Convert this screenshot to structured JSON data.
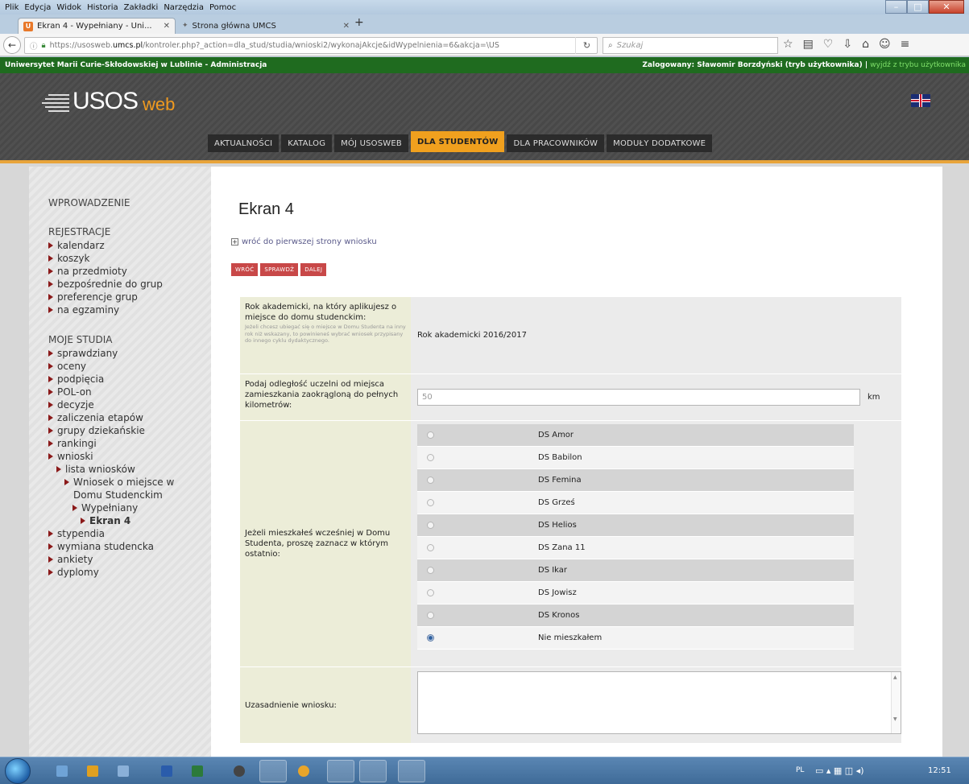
{
  "browser": {
    "menu": [
      "Plik",
      "Edycja",
      "Widok",
      "Historia",
      "Zakładki",
      "Narzędzia",
      "Pomoc"
    ],
    "tabs": [
      {
        "title": "Ekran 4 - Wypełniany - Uni...",
        "active": true
      },
      {
        "title": "Strona główna UMCS",
        "active": false
      }
    ],
    "url": {
      "prefix": "https://usosweb.",
      "host": "umcs.pl",
      "path": "/kontroler.php?_action=dla_stud/studia/wnioski2/wykonajAkcje&idWypelnienia=6&akcja=\\US"
    },
    "search_placeholder": "Szukaj"
  },
  "admin_bar": {
    "left": "Uniwersytet Marii Curie-Skłodowskiej w Lublinie - Administracja",
    "user": "Zalogowany: Sławomir Borzdyński (tryb użytkownika) |",
    "link": "wyjdź z trybu użytkownika"
  },
  "logo": {
    "main": "USOS",
    "suffix": "web"
  },
  "main_nav": [
    {
      "label": "AKTUALNOŚCI",
      "active": false
    },
    {
      "label": "KATALOG",
      "active": false
    },
    {
      "label": "MÓJ USOSWEB",
      "active": false
    },
    {
      "label": "DLA STUDENTÓW",
      "active": true
    },
    {
      "label": "DLA PRACOWNIKÓW",
      "active": false
    },
    {
      "label": "MODUŁY DODATKOWE",
      "active": false
    }
  ],
  "sidebar": {
    "intro": "WPROWADZENIE",
    "registration": {
      "title": "REJESTRACJE",
      "items": [
        "kalendarz",
        "koszyk",
        "na przedmioty",
        "bezpośrednie do grup",
        "preferencje grup",
        "na egzaminy"
      ]
    },
    "studies": {
      "title": "MOJE STUDIA",
      "items": [
        "sprawdziany",
        "oceny",
        "podpięcia",
        "POL-on",
        "decyzje",
        "zaliczenia etapów",
        "grupy dziekańskie",
        "rankingi",
        "wnioski"
      ],
      "nested": [
        "lista wniosków",
        "Wniosek o miejsce w",
        "Domu Studenckim",
        "Wypełniany",
        "Ekran 4"
      ],
      "after": [
        "stypendia",
        "wymiana studencka",
        "ankiety",
        "dyplomy"
      ]
    }
  },
  "content": {
    "title": "Ekran 4",
    "backlink": "wróć do pierwszej strony wniosku",
    "buttons": [
      "WRÓĆ",
      "SPRAWDŹ",
      "DALEJ"
    ],
    "row_year": {
      "label": "Rok akademicki, na który aplikujesz o miejsce do domu studenckim:",
      "note": "Jeżeli chcesz ubiegać się o miejsce w Domu Studenta na inny rok niż wskazany, to powinieneś wybrać wniosek przypisany do innego cyklu dydaktycznego.",
      "value": "Rok akademicki 2016/2017"
    },
    "row_distance": {
      "label": "Podaj odległość uczelni od miejsca zamieszkania zaokrągloną do pełnych kilometrów:",
      "value": "50",
      "unit": "km"
    },
    "row_dorms": {
      "label": "Jeżeli mieszkałeś wcześniej w Domu Studenta, proszę zaznacz w którym ostatnio:",
      "options": [
        {
          "name": "DS Amor",
          "checked": false
        },
        {
          "name": "DS Babilon",
          "checked": false
        },
        {
          "name": "DS Femina",
          "checked": false
        },
        {
          "name": "DS Grześ",
          "checked": false
        },
        {
          "name": "DS Helios",
          "checked": false
        },
        {
          "name": "DS Zana 11",
          "checked": false
        },
        {
          "name": "DS Ikar",
          "checked": false
        },
        {
          "name": "DS Jowisz",
          "checked": false
        },
        {
          "name": "DS Kronos",
          "checked": false
        },
        {
          "name": "Nie mieszkałem",
          "checked": true
        }
      ]
    },
    "row_justification": {
      "label": "Uzasadnienie wniosku:",
      "value": ""
    }
  },
  "taskbar": {
    "lang": "PL",
    "clock": "12:51"
  }
}
